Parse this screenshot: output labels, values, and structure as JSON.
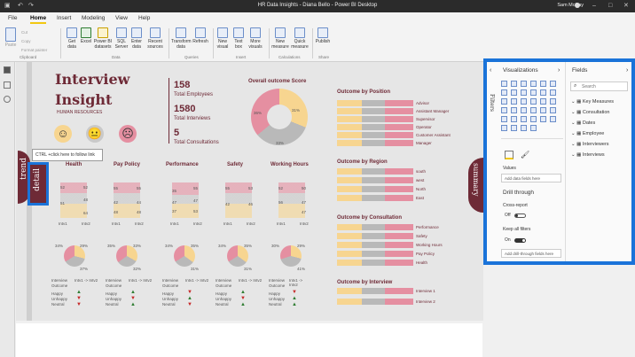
{
  "window": {
    "title": "HR Data Insights - Diana Bello - Power BI Desktop",
    "user": "Sam McKay"
  },
  "tabs": [
    "File",
    "Home",
    "Insert",
    "Modeling",
    "View",
    "Help"
  ],
  "ribbon": {
    "clipboard": {
      "paste": "Paste",
      "cut": "Cut",
      "copy": "Copy",
      "format_painter": "Format painter",
      "group": "Clipboard"
    },
    "data": {
      "items": [
        "Get data",
        "Excel",
        "Power BI datasets",
        "SQL Server",
        "Enter data",
        "Recent sources"
      ],
      "group": "Data"
    },
    "queries": {
      "items": [
        "Transform data",
        "Refresh"
      ],
      "group": "Queries"
    },
    "insert": {
      "items": [
        "New visual",
        "Text box",
        "More visuals"
      ],
      "group": "Insert"
    },
    "calculations": {
      "items": [
        "New measure",
        "Quick measure"
      ],
      "group": "Calculations"
    },
    "share": {
      "items": [
        "Publish"
      ],
      "group": "Share"
    }
  },
  "report": {
    "title_line1": "Interview",
    "title_line2": "Insight",
    "subtitle": "HUMAN RESOURCES",
    "kpis": [
      {
        "value": "158",
        "label": "Total Employees"
      },
      {
        "value": "1580",
        "label": "Total Interviews"
      },
      {
        "value": "5",
        "label": "Total Consultations"
      }
    ],
    "overall_title": "Overall outcome Score",
    "overall_pcts": [
      "36%",
      "31%",
      "33%"
    ],
    "tooltip": "CTRL +click here to follow link",
    "side_left": "trend",
    "side_detail": "detail",
    "side_right": "summary",
    "categories": [
      "Health",
      "Pay Policy",
      "Performance",
      "Safety",
      "Working Hours"
    ],
    "mini_values": [
      [
        "52",
        "52",
        "51",
        "48",
        "64"
      ],
      [
        "55",
        "55",
        "42",
        "44",
        "48",
        "48"
      ],
      [
        "35",
        "55",
        "47",
        "47",
        "37",
        "53"
      ],
      [
        "55",
        "53",
        "42",
        "46"
      ],
      [
        "52",
        "50",
        "56",
        "47",
        "47"
      ]
    ],
    "mini_axis": [
      "Intv1",
      "Intv2"
    ],
    "donut_pcts": [
      [
        "34%",
        "37%",
        "29%"
      ],
      [
        "35%",
        "32%",
        "33%"
      ],
      [
        "34%",
        "31%",
        "35%"
      ],
      [
        "34%",
        "31%",
        "35%"
      ],
      [
        "30%",
        "41%",
        "29%"
      ]
    ],
    "change_labels": {
      "interview": "Interview",
      "outcome": "Outcome",
      "arrow": "Intv1 -> Intv2",
      "happy": "Happy",
      "unhappy": "Unhappy",
      "neutral": "Neutral"
    },
    "position": {
      "title": "Outcome by Position",
      "items": [
        "Advisor",
        "Assistant Manager",
        "Supervisor",
        "Operator",
        "Customer Assistant",
        "Manager"
      ]
    },
    "region": {
      "title": "Outcome by Region",
      "items": [
        "south",
        "west",
        "North",
        "East"
      ]
    },
    "consultation": {
      "title": "Outcome by Consultation",
      "items": [
        "Performance",
        "Safety",
        "Working Hours",
        "Pay Policy",
        "Health"
      ]
    },
    "interview": {
      "title": "Outcome by Interview",
      "items": [
        "Interview 1",
        "Interview 2"
      ]
    }
  },
  "visualizations": {
    "title": "Visualizations",
    "filters_label": "Filters",
    "values_label": "Values",
    "add_data": "Add data fields here",
    "drill_title": "Drill through",
    "cross_report": "Cross-report",
    "off": "Off",
    "keep_filters": "Keep all filters",
    "on": "On",
    "add_drill": "Add drill-through fields here"
  },
  "fields": {
    "title": "Fields",
    "search_placeholder": "Search",
    "tables": [
      "Key Measures",
      "Consultation",
      "Dates",
      "Employee",
      "Interviewers",
      "Interviews"
    ]
  },
  "colors": {
    "yellow": "#f7d590",
    "grey": "#b9b9b9",
    "pink": "#e58fa1",
    "maroon": "#6e2a36",
    "accent": "#1a73d9"
  }
}
